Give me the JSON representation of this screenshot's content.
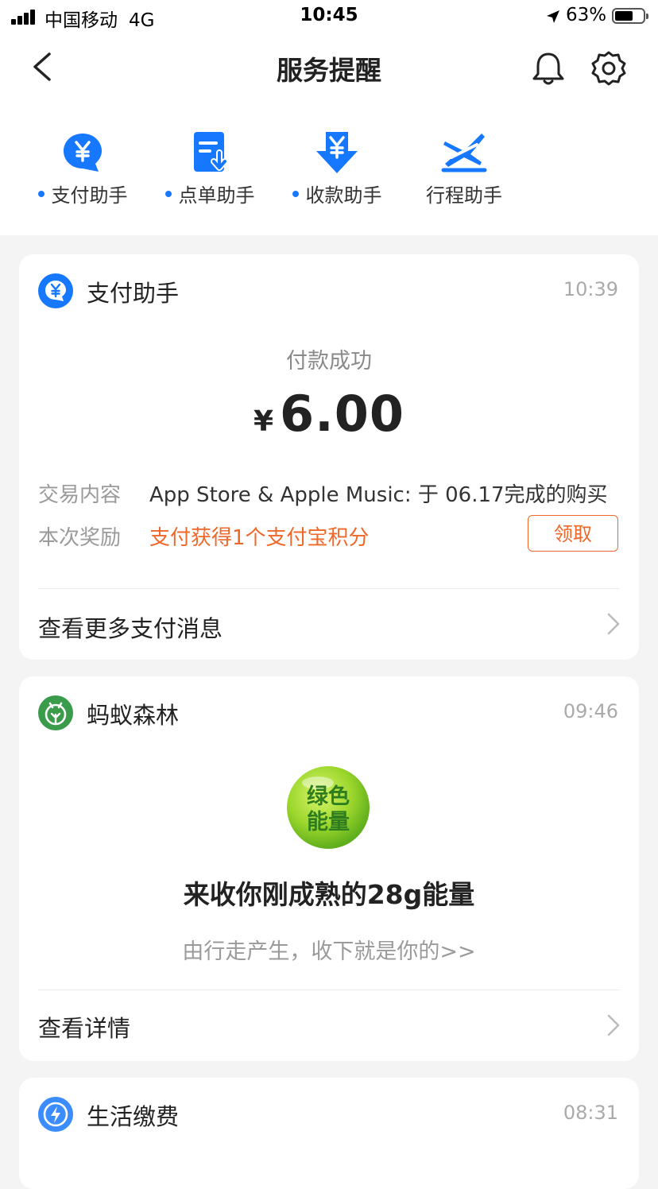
{
  "status_bar": {
    "carrier": "中国移动",
    "network": "4G",
    "time": "10:45",
    "battery_percent": "63%",
    "battery_level": 0.63
  },
  "header": {
    "title": "服务提醒",
    "back_icon": "chevron-left-icon",
    "bell_icon": "bell-icon",
    "settings_icon": "gear-icon"
  },
  "tabs": [
    {
      "label": "支付助手",
      "icon": "yen-bubble-icon",
      "unread": true
    },
    {
      "label": "点单助手",
      "icon": "order-list-icon",
      "unread": true
    },
    {
      "label": "收款助手",
      "icon": "yen-download-icon",
      "unread": true
    },
    {
      "label": "行程助手",
      "icon": "flight-icon",
      "unread": false
    }
  ],
  "cards": {
    "payment": {
      "title": "支付助手",
      "time": "10:39",
      "status": "付款成功",
      "currency": "¥",
      "amount": "6.00",
      "content_label": "交易内容",
      "content_value": "App Store & Apple Music: 于 06.17完成的购买",
      "reward_label": "本次奖励",
      "reward_value": "支付获得1个支付宝积分",
      "claim_button": "领取",
      "more_link": "查看更多支付消息"
    },
    "forest": {
      "title": "蚂蚁森林",
      "time": "09:46",
      "ball_line1": "绿色",
      "ball_line2": "能量",
      "headline": "来收你刚成熟的28g能量",
      "sub": "由行走产生，收下就是你的>>",
      "details_link": "查看详情"
    },
    "utilities": {
      "title": "生活缴费",
      "time": "08:31"
    }
  },
  "colors": {
    "accent_blue": "#1677ff",
    "orange": "#f0672a",
    "forest_green": "#3a9b4a",
    "energy_green": "#8ed12a"
  }
}
